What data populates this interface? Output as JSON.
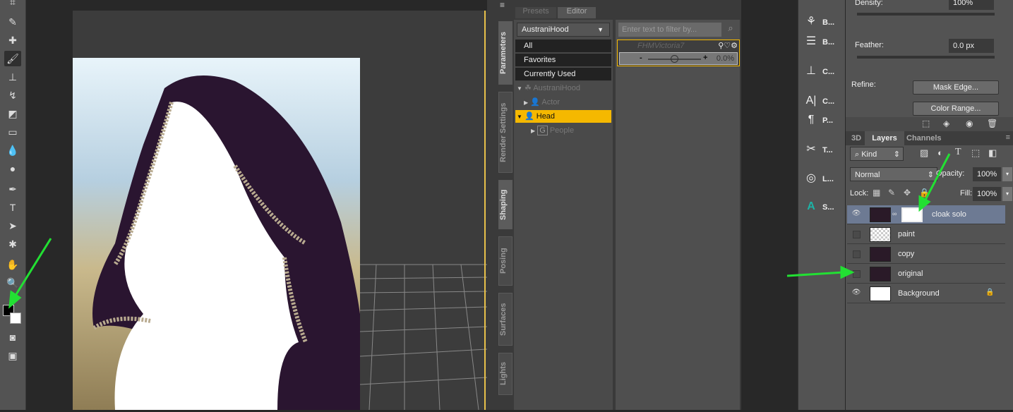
{
  "daz": {
    "tabs": [
      "Presets",
      "Editor"
    ],
    "side_tabs": [
      "Parameters",
      "Render Settings",
      "Shaping",
      "Posing",
      "Surfaces",
      "Lights"
    ],
    "node_dropdown": "AustraniHood",
    "categories": [
      "All",
      "Favorites",
      "Currently Used"
    ],
    "tree": [
      {
        "label": "AustraniHood"
      },
      {
        "label": "Actor"
      },
      {
        "label": "Head",
        "selected": true
      },
      {
        "label": "People",
        "icon": "G"
      }
    ],
    "filter_placeholder": "Enter text to filter by...",
    "param": {
      "name": "FHMVictoria7",
      "minus": "-",
      "plus": "+",
      "value": "0.0%"
    },
    "highlight_color": "#f5b800"
  },
  "ps_panels": [
    {
      "icon": "brush-presets-icon",
      "label": "B..."
    },
    {
      "icon": "brush-icon",
      "label": "B..."
    },
    {
      "icon": "clone-source-icon",
      "label": "C..."
    },
    {
      "icon": "character-icon",
      "label": "C..."
    },
    {
      "icon": "paragraph-icon",
      "label": "P..."
    },
    {
      "icon": "tool-presets-icon",
      "label": "T..."
    },
    {
      "icon": "libraries-icon",
      "label": "L..."
    },
    {
      "icon": "stock-icon",
      "label": "S..."
    }
  ],
  "properties": {
    "density_label": "Density:",
    "density_value": "100%",
    "feather_label": "Feather:",
    "feather_value": "0.0 px",
    "refine_label": "Refine:",
    "mask_edge": "Mask Edge...",
    "color_range": "Color Range..."
  },
  "layers_panel": {
    "tabs": [
      "3D",
      "Layers",
      "Channels"
    ],
    "kind": "Kind",
    "blend_mode": "Normal",
    "opacity_label": "Opacity:",
    "opacity": "100%",
    "lock_label": "Lock:",
    "fill_label": "Fill:",
    "fill": "100%",
    "layers": [
      {
        "name": "cloak solo",
        "visible": true,
        "selected": true
      },
      {
        "name": "paint",
        "visible": false
      },
      {
        "name": "copy",
        "visible": false
      },
      {
        "name": "original",
        "visible": false
      },
      {
        "name": "Background",
        "visible": true,
        "locked": true
      }
    ]
  },
  "annotation_color": "#22e033"
}
